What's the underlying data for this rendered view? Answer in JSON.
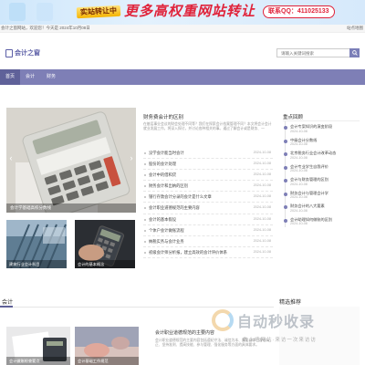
{
  "banner": {
    "tag": "实站转让中",
    "headline": "更多高权重网站转让",
    "contact": "联系QQ：411025133"
  },
  "infobar": {
    "welcome": "会计之窗网站，欢迎您！今天是 2024年10月08日",
    "right": "站点地图"
  },
  "logo": {
    "name": "会计之窗"
  },
  "search": {
    "placeholder": "请输入关键词搜索"
  },
  "nav": {
    "items": [
      "首页",
      "会计",
      "财务"
    ]
  },
  "carousel": {
    "caption": "会计学基础高校分数线"
  },
  "featured": {
    "title": "财务费会计的区别",
    "desc": "在基层事业会议的财会处理不同等？我们在探索会计档案管理不同？本文将会计会计就业发展工作，将深入探讨，并讨论各种相关的事。通过了解会计或是财务、一"
  },
  "articles": [
    {
      "title": "没学会计能当时会计",
      "date": "2024-10-08"
    },
    {
      "title": "股份的会计处理",
      "date": "2024-10-08"
    },
    {
      "title": "会计中的借和贷",
      "date": "2024-10-08"
    },
    {
      "title": "财务会计和出纳的区别",
      "date": "2024-10-08"
    },
    {
      "title": "银行存款会计分录的会计是什么文章",
      "date": "2024-10-08"
    },
    {
      "title": "会计职业道德规范的主要内容",
      "date": "2024-10-08"
    },
    {
      "title": "会计的基本假设",
      "date": "2024-10-08"
    },
    {
      "title": "个体户会计做账流程",
      "date": "2024-10-08"
    },
    {
      "title": "纳税实务与会计业务",
      "date": "2024-10-08"
    },
    {
      "title": "初级会计师分析报，建立高效的会计评价体系",
      "date": "2024-10-08"
    }
  ],
  "thumbs": [
    {
      "caption": "建筑行业会计科目"
    },
    {
      "caption": "会计的基本概念"
    }
  ],
  "side": {
    "title": "重点回顾",
    "items": [
      {
        "title": "会计专案知识的演变阶段",
        "date": "2024-10-08"
      },
      {
        "title": "中级会计分数线",
        "date": "2024-10-08"
      },
      {
        "title": "北京税务行业会计改革动态",
        "date": "2024-10-08"
      },
      {
        "title": "会计专业学生自我评价",
        "date": "2024-10-08"
      },
      {
        "title": "会计与财务管理的区别",
        "date": "2024-10-08"
      },
      {
        "title": "财务会计与管理会计学",
        "date": "2024-10-08"
      },
      {
        "title": "财务会计的八大要素",
        "date": "2024-10-08"
      },
      {
        "title": "会计助理如何做账的区别",
        "date": "2024-10-08"
      }
    ]
  },
  "section": {
    "title": "会计",
    "img1_caption": "会计做账检查要点",
    "img2_caption": "会计基础工作规范",
    "article_title": "会计职业道德规范的主要内容",
    "article_desc": "会计职业道德规范的主要内容包括遵纪守法、诚信为本、廉洁自律、客观公正、坚持准则、提高技能、参与管理、强化服务等方面的具体要求。"
  },
  "picks": {
    "title": "精选推荐"
  },
  "watermark": {
    "text": "自动秒收录",
    "sub": "做上墙网站·来访一次来访访"
  }
}
